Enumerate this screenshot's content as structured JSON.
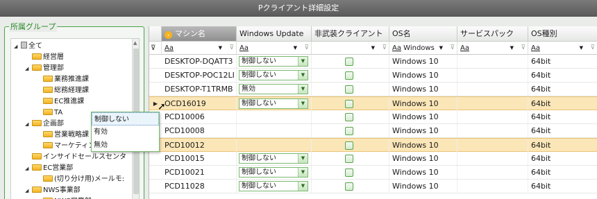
{
  "window": {
    "title": "Pクライアント詳細設定"
  },
  "left_panel": {
    "legend": "所属グループ",
    "tree": [
      {
        "label": "全て",
        "level": 0,
        "expanded": true,
        "kind": "root"
      },
      {
        "label": "経営層",
        "level": 1,
        "expanded": false,
        "kind": "folder"
      },
      {
        "label": "管理部",
        "level": 1,
        "expanded": true,
        "kind": "folder"
      },
      {
        "label": "業務推進課",
        "level": 2,
        "expanded": false,
        "kind": "folder"
      },
      {
        "label": "総務経理課",
        "level": 2,
        "expanded": false,
        "kind": "folder"
      },
      {
        "label": "EC推進課",
        "level": 2,
        "expanded": false,
        "kind": "folder"
      },
      {
        "label": "TA",
        "level": 2,
        "expanded": false,
        "kind": "folder"
      },
      {
        "label": "企画部",
        "level": 1,
        "expanded": true,
        "kind": "folder"
      },
      {
        "label": "営業戦略課",
        "level": 2,
        "expanded": false,
        "kind": "folder"
      },
      {
        "label": "マーケティング課",
        "level": 2,
        "expanded": false,
        "kind": "folder"
      },
      {
        "label": "インサイドセールスセンタ",
        "level": 1,
        "expanded": false,
        "kind": "folder"
      },
      {
        "label": "EC営業部",
        "level": 1,
        "expanded": true,
        "kind": "folder"
      },
      {
        "label": "(切り分け用)メールモ:",
        "level": 2,
        "expanded": false,
        "kind": "folder"
      },
      {
        "label": "NWS事業部",
        "level": 1,
        "expanded": true,
        "kind": "folder"
      },
      {
        "label": "NWS営業部",
        "level": 2,
        "expanded": false,
        "kind": "folder"
      }
    ]
  },
  "grid": {
    "columns": [
      "マシン名",
      "Windows Update",
      "非武装クライアント",
      "OS名",
      "サービスパック",
      "OS種別"
    ],
    "filters": {
      "aa": "Aa",
      "os_value": "Windows"
    },
    "rows": [
      {
        "machine": "DESKTOP-DQATT3",
        "update": "制御しない",
        "os": "Windows 10",
        "sp": "",
        "type": "64bit",
        "selected": false,
        "current": false
      },
      {
        "machine": "DESKTOP-POC12LI",
        "update": "制御しない",
        "os": "Windows 10",
        "sp": "",
        "type": "64bit",
        "selected": false,
        "current": false
      },
      {
        "machine": "DESKTOP-T1TRMB",
        "update": "無効",
        "os": "Windows 10",
        "sp": "",
        "type": "64bit",
        "selected": false,
        "current": false
      },
      {
        "machine": "OCD16019",
        "update": "制御しない",
        "os": "Windows 10",
        "sp": "",
        "type": "64bit",
        "selected": true,
        "current": true
      },
      {
        "machine": "PCD10006",
        "update": "",
        "os": "Windows 10",
        "sp": "",
        "type": "64bit",
        "selected": false,
        "current": false
      },
      {
        "machine": "PCD10008",
        "update": "",
        "os": "Windows 10",
        "sp": "",
        "type": "64bit",
        "selected": false,
        "current": false
      },
      {
        "machine": "PCD10012",
        "update": "",
        "os": "Windows 10",
        "sp": "",
        "type": "64bit",
        "selected": true,
        "current": false
      },
      {
        "machine": "PCD10015",
        "update": "制御しない",
        "os": "Windows 10",
        "sp": "",
        "type": "64bit",
        "selected": false,
        "current": false
      },
      {
        "machine": "PCD10021",
        "update": "制御しない",
        "os": "Windows 10",
        "sp": "",
        "type": "64bit",
        "selected": false,
        "current": false
      },
      {
        "machine": "PCD11028",
        "update": "制御しない",
        "os": "Windows 10",
        "sp": "",
        "type": "64bit",
        "selected": false,
        "current": false
      }
    ],
    "dropdown_options": [
      "制御しない",
      "有効",
      "無効"
    ],
    "dropdown_highlight": "制御しない"
  }
}
